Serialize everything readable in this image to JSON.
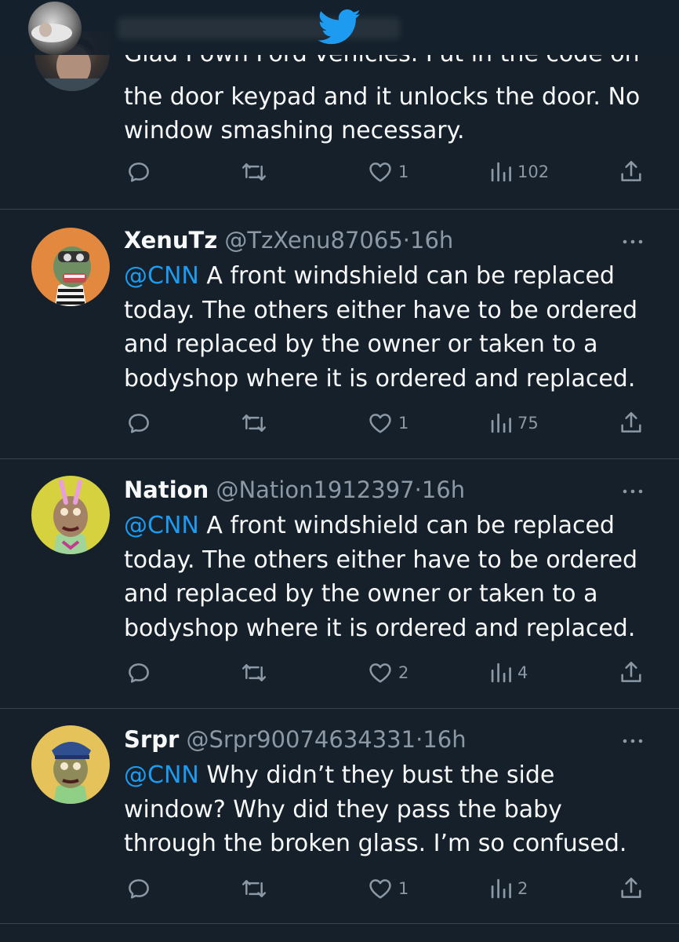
{
  "top": {
    "logo": "twitter-bird-icon"
  },
  "tweets": [
    {
      "cut_text": "Glad I own Ford vehicles. Put in the code on",
      "body": "the door keypad and it unlocks the door. No window smashing necessary.",
      "likes": "1",
      "views": "102"
    },
    {
      "name": "XenuTz",
      "handle": "@TzXenu87065",
      "dot": "·",
      "time": "16h",
      "mention": "@CNN",
      "text": " A front windshield can be replaced today. The others either have to be ordered and replaced by the owner or taken to a bodyshop where it is ordered and replaced.",
      "likes": "1",
      "views": "75"
    },
    {
      "name": "Nation",
      "handle": "@Nation1912397",
      "dot": "·",
      "time": "16h",
      "mention": "@CNN",
      "text": " A front windshield can be replaced today. The others either have to be ordered and replaced by the owner or taken to a bodyshop where it is ordered and replaced.",
      "likes": "2",
      "views": "4"
    },
    {
      "name": "Srpr",
      "handle": "@Srpr90074634331",
      "dot": "·",
      "time": "16h",
      "mention": "@CNN",
      "text": " Why didn’t they bust the side window? Why did they pass the baby through the broken glass. I’m so confused.",
      "likes": "1",
      "views": "2"
    }
  ],
  "colors": {
    "background": "#15202b",
    "text": "#f7f9f9",
    "secondary": "#8b98a5",
    "accent": "#1d9bf0",
    "divider": "#38444d"
  }
}
